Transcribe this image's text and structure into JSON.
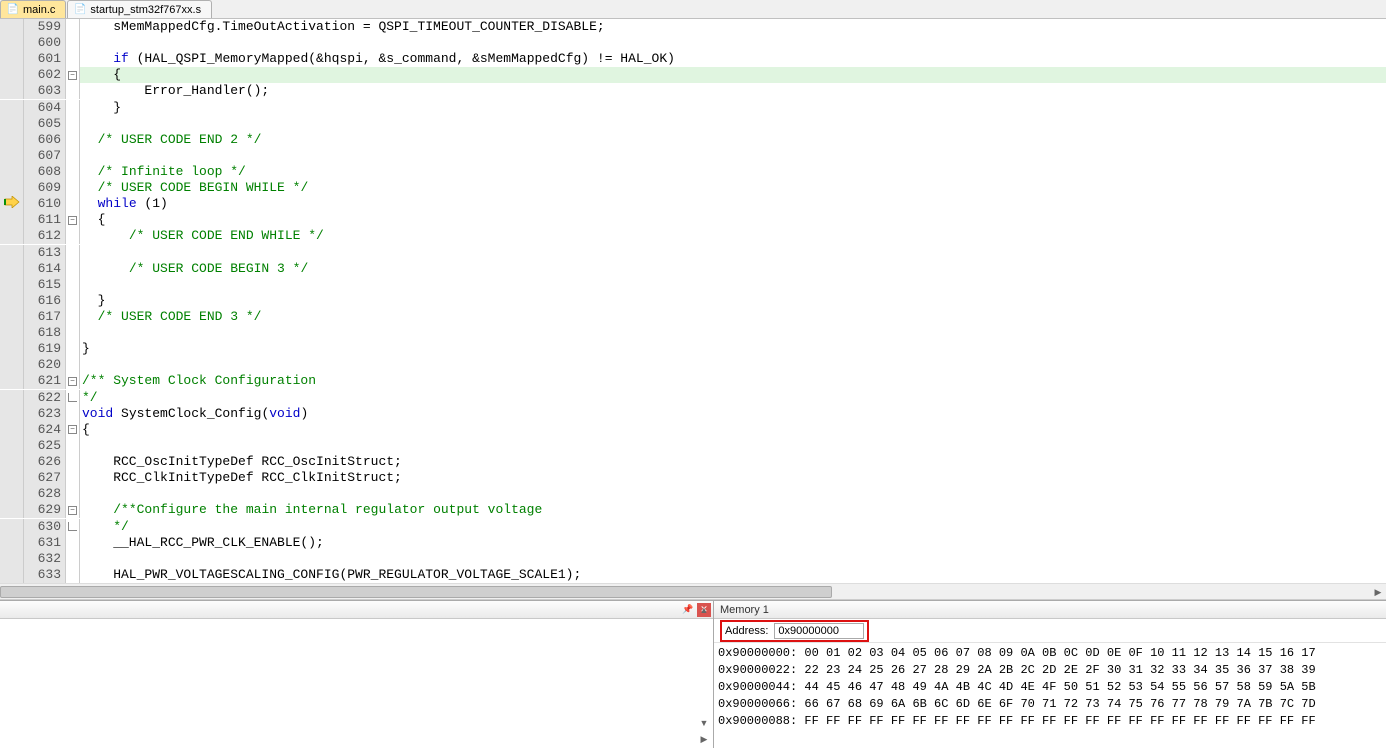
{
  "tabs": [
    {
      "label": "main.c",
      "icon": "c",
      "active": true
    },
    {
      "label": "startup_stm32f767xx.s",
      "icon": "s",
      "active": false
    }
  ],
  "code": [
    {
      "n": 599,
      "bp": "",
      "fold": "",
      "hl": false,
      "segs": [
        {
          "t": "    sMemMappedCfg.TimeOutActivation = QSPI_TIMEOUT_COUNTER_DISABLE;",
          "c": ""
        }
      ]
    },
    {
      "n": 600,
      "bp": "",
      "fold": "",
      "hl": false,
      "segs": [
        {
          "t": "",
          "c": ""
        }
      ]
    },
    {
      "n": 601,
      "bp": "",
      "fold": "",
      "hl": false,
      "segs": [
        {
          "t": "    ",
          "c": ""
        },
        {
          "t": "if",
          "c": "kw"
        },
        {
          "t": " (HAL_QSPI_MemoryMapped(&hqspi, &s_command, &sMemMappedCfg) != HAL_OK)",
          "c": ""
        }
      ]
    },
    {
      "n": 602,
      "bp": "",
      "fold": "-",
      "hl": true,
      "segs": [
        {
          "t": "    {",
          "c": ""
        }
      ]
    },
    {
      "n": 603,
      "bp": "",
      "fold": "",
      "hl": false,
      "segs": [
        {
          "t": "        Error_Handler();",
          "c": ""
        }
      ]
    },
    {
      "n": 604,
      "bp": "",
      "fold": "",
      "hl": false,
      "segs": [
        {
          "t": "    }",
          "c": ""
        }
      ]
    },
    {
      "n": 605,
      "bp": "",
      "fold": "",
      "hl": false,
      "segs": [
        {
          "t": "",
          "c": ""
        }
      ]
    },
    {
      "n": 606,
      "bp": "",
      "fold": "",
      "hl": false,
      "segs": [
        {
          "t": "  ",
          "c": ""
        },
        {
          "t": "/* USER CODE END 2 */",
          "c": "cm"
        }
      ]
    },
    {
      "n": 607,
      "bp": "",
      "fold": "",
      "hl": false,
      "segs": [
        {
          "t": "",
          "c": ""
        }
      ]
    },
    {
      "n": 608,
      "bp": "",
      "fold": "",
      "hl": false,
      "segs": [
        {
          "t": "  ",
          "c": ""
        },
        {
          "t": "/* Infinite loop */",
          "c": "cm"
        }
      ]
    },
    {
      "n": 609,
      "bp": "",
      "fold": "",
      "hl": false,
      "segs": [
        {
          "t": "  ",
          "c": ""
        },
        {
          "t": "/* USER CODE BEGIN WHILE */",
          "c": "cm"
        }
      ]
    },
    {
      "n": 610,
      "bp": "arrow",
      "fold": "",
      "hl": false,
      "segs": [
        {
          "t": "  ",
          "c": ""
        },
        {
          "t": "while",
          "c": "kw"
        },
        {
          "t": " (1)",
          "c": ""
        }
      ]
    },
    {
      "n": 611,
      "bp": "",
      "fold": "-",
      "hl": false,
      "segs": [
        {
          "t": "  {",
          "c": ""
        }
      ]
    },
    {
      "n": 612,
      "bp": "",
      "fold": "",
      "hl": false,
      "segs": [
        {
          "t": "      ",
          "c": ""
        },
        {
          "t": "/* USER CODE END WHILE */",
          "c": "cm"
        }
      ]
    },
    {
      "n": 613,
      "bp": "",
      "fold": "",
      "hl": false,
      "segs": [
        {
          "t": "",
          "c": ""
        }
      ]
    },
    {
      "n": 614,
      "bp": "",
      "fold": "",
      "hl": false,
      "segs": [
        {
          "t": "      ",
          "c": ""
        },
        {
          "t": "/* USER CODE BEGIN 3 */",
          "c": "cm"
        }
      ]
    },
    {
      "n": 615,
      "bp": "",
      "fold": "",
      "hl": false,
      "segs": [
        {
          "t": "",
          "c": ""
        }
      ]
    },
    {
      "n": 616,
      "bp": "",
      "fold": "",
      "hl": false,
      "segs": [
        {
          "t": "  }",
          "c": ""
        }
      ]
    },
    {
      "n": 617,
      "bp": "",
      "fold": "",
      "hl": false,
      "segs": [
        {
          "t": "  ",
          "c": ""
        },
        {
          "t": "/* USER CODE END 3 */",
          "c": "cm"
        }
      ]
    },
    {
      "n": 618,
      "bp": "",
      "fold": "",
      "hl": false,
      "segs": [
        {
          "t": "",
          "c": ""
        }
      ]
    },
    {
      "n": 619,
      "bp": "",
      "fold": "",
      "hl": false,
      "segs": [
        {
          "t": "}",
          "c": ""
        }
      ]
    },
    {
      "n": 620,
      "bp": "",
      "fold": "",
      "hl": false,
      "segs": [
        {
          "t": "",
          "c": ""
        }
      ]
    },
    {
      "n": 621,
      "bp": "",
      "fold": "-",
      "hl": false,
      "segs": [
        {
          "t": "/** System Clock Configuration",
          "c": "cm"
        }
      ]
    },
    {
      "n": 622,
      "bp": "",
      "fold": "e",
      "hl": false,
      "segs": [
        {
          "t": "*/",
          "c": "cm"
        }
      ]
    },
    {
      "n": 623,
      "bp": "",
      "fold": "",
      "hl": false,
      "segs": [
        {
          "t": "void",
          "c": "kw"
        },
        {
          "t": " SystemClock_Config(",
          "c": ""
        },
        {
          "t": "void",
          "c": "kw"
        },
        {
          "t": ")",
          "c": ""
        }
      ]
    },
    {
      "n": 624,
      "bp": "",
      "fold": "-",
      "hl": false,
      "segs": [
        {
          "t": "{",
          "c": ""
        }
      ]
    },
    {
      "n": 625,
      "bp": "",
      "fold": "",
      "hl": false,
      "segs": [
        {
          "t": "",
          "c": ""
        }
      ]
    },
    {
      "n": 626,
      "bp": "",
      "fold": "",
      "hl": false,
      "segs": [
        {
          "t": "    RCC_OscInitTypeDef RCC_OscInitStruct;",
          "c": ""
        }
      ]
    },
    {
      "n": 627,
      "bp": "",
      "fold": "",
      "hl": false,
      "segs": [
        {
          "t": "    RCC_ClkInitTypeDef RCC_ClkInitStruct;",
          "c": ""
        }
      ]
    },
    {
      "n": 628,
      "bp": "",
      "fold": "",
      "hl": false,
      "segs": [
        {
          "t": "",
          "c": ""
        }
      ]
    },
    {
      "n": 629,
      "bp": "",
      "fold": "-",
      "hl": false,
      "segs": [
        {
          "t": "    ",
          "c": ""
        },
        {
          "t": "/**Configure the main internal regulator output voltage",
          "c": "cm"
        }
      ]
    },
    {
      "n": 630,
      "bp": "",
      "fold": "e",
      "hl": false,
      "segs": [
        {
          "t": "    ",
          "c": ""
        },
        {
          "t": "*/",
          "c": "cm"
        }
      ]
    },
    {
      "n": 631,
      "bp": "",
      "fold": "",
      "hl": false,
      "segs": [
        {
          "t": "    __HAL_RCC_PWR_CLK_ENABLE();",
          "c": ""
        }
      ]
    },
    {
      "n": 632,
      "bp": "",
      "fold": "",
      "hl": false,
      "segs": [
        {
          "t": "",
          "c": ""
        }
      ]
    },
    {
      "n": 633,
      "bp": "",
      "fold": "",
      "hl": false,
      "segs": [
        {
          "t": "    HAL_PWR_VOLTAGESCALING_CONFIG(PWR_REGULATOR_VOLTAGE_SCALE1);",
          "c": ""
        }
      ]
    }
  ],
  "memory_panel": {
    "title": "Memory 1",
    "address_label": "Address:",
    "address_value": "0x90000000",
    "rows": [
      {
        "addr": "0x90000000",
        "bytes": "00 01 02 03 04 05 06 07 08 09 0A 0B 0C 0D 0E 0F 10 11 12 13 14 15 16 17"
      },
      {
        "addr": "0x90000022",
        "bytes": "22 23 24 25 26 27 28 29 2A 2B 2C 2D 2E 2F 30 31 32 33 34 35 36 37 38 39"
      },
      {
        "addr": "0x90000044",
        "bytes": "44 45 46 47 48 49 4A 4B 4C 4D 4E 4F 50 51 52 53 54 55 56 57 58 59 5A 5B"
      },
      {
        "addr": "0x90000066",
        "bytes": "66 67 68 69 6A 6B 6C 6D 6E 6F 70 71 72 73 74 75 76 77 78 79 7A 7B 7C 7D"
      },
      {
        "addr": "0x90000088",
        "bytes": "FF FF FF FF FF FF FF FF FF FF FF FF FF FF FF FF FF FF FF FF FF FF FF FF"
      }
    ]
  }
}
